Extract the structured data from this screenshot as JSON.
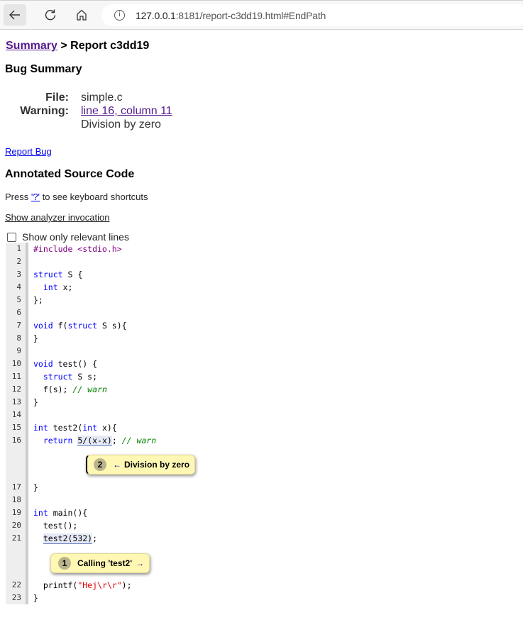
{
  "browser": {
    "url_host": "127.0.0.1",
    "url_rest": ":8181/report-c3dd19.html#EndPath",
    "icons": [
      "back-arrow-icon",
      "reload-icon",
      "home-icon",
      "info-icon"
    ]
  },
  "breadcrumb": {
    "summary_link": "Summary",
    "separator": " > ",
    "current": "Report c3dd19"
  },
  "bug_summary": {
    "title": "Bug Summary",
    "file_label": "File:",
    "file_value": "simple.c",
    "warning_label": "Warning:",
    "warning_link": "line 16, column 11",
    "warning_text": "Division by zero"
  },
  "report_bug": "Report Bug",
  "annotated": {
    "title": "Annotated Source Code",
    "press_prefix": "Press ",
    "press_key": "'?'",
    "press_suffix": " to see keyboard shortcuts",
    "show_invocation": "Show analyzer invocation",
    "relevant_label": "Show only relevant lines",
    "relevant_checked": false
  },
  "code": {
    "line_numbers": [
      "1",
      "2",
      "3",
      "4",
      "5",
      "6",
      "7",
      "8",
      "9",
      "10",
      "11",
      "12",
      "13",
      "14",
      "15",
      "16",
      "17",
      "18",
      "19",
      "20",
      "21",
      "22",
      "23"
    ],
    "t1_pp": "#include <stdio.h>",
    "t3_kw": "struct",
    "t3_rest": " S {",
    "t4_kw": "int",
    "t4_rest": " x;",
    "t5": "};",
    "t7_kw": "void",
    "t7_a": " f(",
    "t7_kw2": "struct",
    "t7_b": " S s){",
    "t8": "}",
    "t10_kw": "void",
    "t10_rest": " test() {",
    "t11_kw": "struct",
    "t11_rest": " S s;",
    "t12_a": "f(s); ",
    "t12_cm": "// warn",
    "t13": "}",
    "t15_kw": "int",
    "t15_a": " test2(",
    "t15_kw2": "int",
    "t15_b": " x){",
    "t16_kw": "return",
    "t16_hl": "5/(x-x)",
    "t16_a": "; ",
    "t16_cm": "// warn",
    "t17": "}",
    "t19_kw": "int",
    "t19_rest": " main(){",
    "t20": "test();",
    "t21_hl": "test2(532)",
    "t21_a": ";",
    "t22_a": "printf(",
    "t22_str": "\"Hej\\r\\r\"",
    "t22_b": ");",
    "t23": "}"
  },
  "path_notes": [
    {
      "step": "1",
      "text": "Calling 'test2'",
      "arrow": "→"
    },
    {
      "step": "2",
      "text": "Division by zero",
      "arrow": "←"
    }
  ]
}
